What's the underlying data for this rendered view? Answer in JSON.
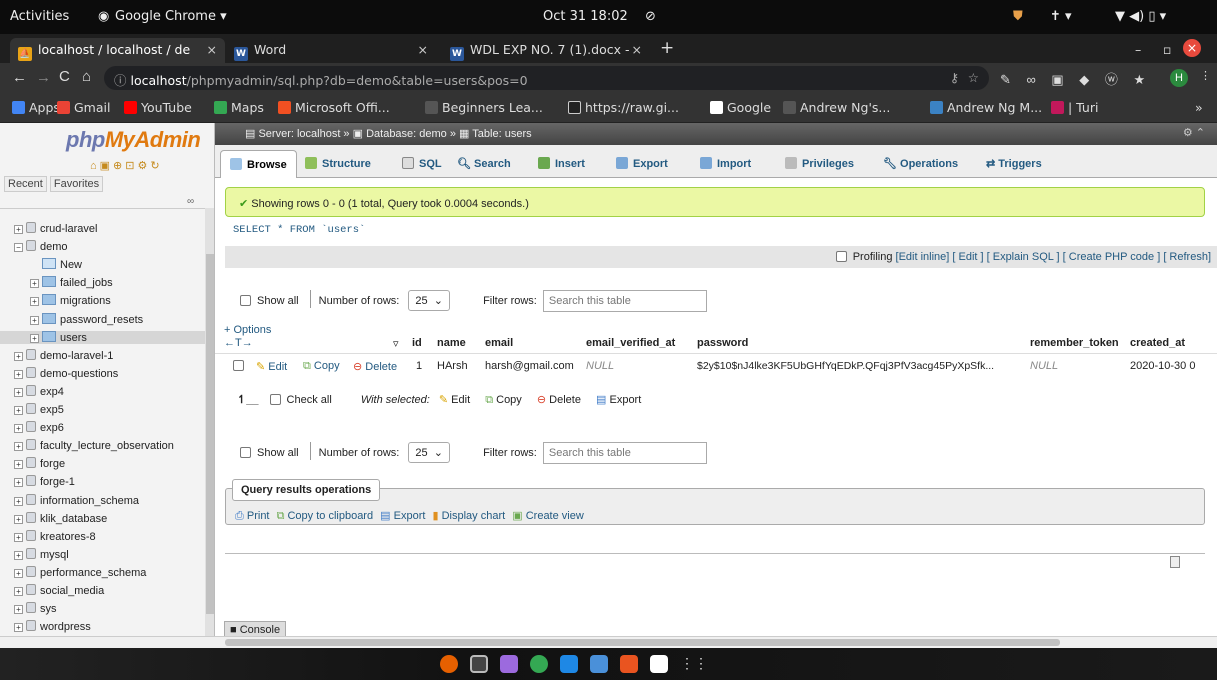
{
  "topbar": {
    "activities": "Activities",
    "app": "Google Chrome ▾",
    "clock": "Oct 31  18:02"
  },
  "tabs": [
    {
      "label": "localhost / localhost / de",
      "active": true
    },
    {
      "label": "Word",
      "active": false
    },
    {
      "label": "WDL EXP NO. 7 (1).docx -",
      "active": false
    }
  ],
  "omnibox": {
    "host": "localhost",
    "path": "/phpmyadmin/sql.php?db=demo&table=users&pos=0"
  },
  "bookmarks": [
    "Apps",
    "Gmail",
    "YouTube",
    "Maps",
    "Microsoft Offi...",
    "Beginners Lea...",
    "https://raw.gi...",
    "Google",
    "Andrew Ng's...",
    "Andrew Ng M...",
    "| Turi"
  ],
  "sidebar": {
    "logo_php": "php",
    "logo_myadmin": "MyAdmin",
    "recent": "Recent",
    "favorites": "Favorites",
    "items": [
      {
        "label": "crud-laravel",
        "kind": "db"
      },
      {
        "label": "demo",
        "kind": "db-open"
      },
      {
        "label": "New",
        "kind": "new"
      },
      {
        "label": "failed_jobs",
        "kind": "table"
      },
      {
        "label": "migrations",
        "kind": "table"
      },
      {
        "label": "password_resets",
        "kind": "table"
      },
      {
        "label": "users",
        "kind": "table"
      },
      {
        "label": "demo-laravel-1",
        "kind": "db"
      },
      {
        "label": "demo-questions",
        "kind": "db"
      },
      {
        "label": "exp4",
        "kind": "db"
      },
      {
        "label": "exp5",
        "kind": "db"
      },
      {
        "label": "exp6",
        "kind": "db"
      },
      {
        "label": "faculty_lecture_observation",
        "kind": "db"
      },
      {
        "label": "forge",
        "kind": "db"
      },
      {
        "label": "forge-1",
        "kind": "db"
      },
      {
        "label": "information_schema",
        "kind": "db"
      },
      {
        "label": "klik_database",
        "kind": "db"
      },
      {
        "label": "kreatores-8",
        "kind": "db"
      },
      {
        "label": "mysql",
        "kind": "db"
      },
      {
        "label": "performance_schema",
        "kind": "db"
      },
      {
        "label": "social_media",
        "kind": "db"
      },
      {
        "label": "sys",
        "kind": "db"
      },
      {
        "label": "wordpress",
        "kind": "db"
      }
    ]
  },
  "breadcrumb": {
    "server": "Server: localhost »",
    "database": "Database: demo »",
    "table": "Table: users"
  },
  "ptabs": [
    "Browse",
    "Structure",
    "SQL",
    "Search",
    "Insert",
    "Export",
    "Import",
    "Privileges",
    "Operations",
    "Triggers"
  ],
  "success": "Showing rows 0 - 0 (1 total, Query took 0.0004 seconds.)",
  "sql": "SELECT * FROM `users`",
  "profiling": {
    "label": "Profiling",
    "links": "[Edit inline] [ Edit ] [ Explain SQL ] [ Create PHP code ] [ Refresh]"
  },
  "nav": {
    "show_all": "Show all",
    "rows_label": "Number of rows:",
    "rows_value": "25",
    "filter_label": "Filter rows:",
    "filter_placeholder": "Search this table"
  },
  "options": "+ Options",
  "columns": [
    "id",
    "name",
    "email",
    "email_verified_at",
    "password",
    "remember_token",
    "created_at"
  ],
  "row": {
    "edit": "Edit",
    "copy": "Copy",
    "delete": "Delete",
    "id": "1",
    "name": "HArsh",
    "email": "harsh@gmail.com",
    "email_verified_at": "NULL",
    "password": "$2y$10$nJ4lke3KF5UbGHfYqEDkP.QFqj3PfV3acg45PyXpSfk...",
    "remember_token": "NULL",
    "created_at": "2020-10-30 0"
  },
  "bulk": {
    "check_all": "Check all",
    "with_selected": "With selected:",
    "edit": "Edit",
    "copy": "Copy",
    "delete": "Delete",
    "export": "Export"
  },
  "qro": {
    "title": "Query results operations",
    "print": "Print",
    "copy": "Copy to clipboard",
    "export": "Export",
    "chart": "Display chart",
    "view": "Create view"
  },
  "console": "Console"
}
